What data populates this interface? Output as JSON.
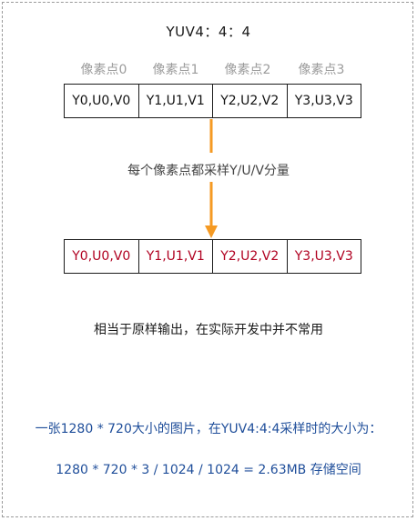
{
  "title": "YUV4：4：4",
  "pixel_labels": [
    "像素点0",
    "像素点1",
    "像素点2",
    "像素点3"
  ],
  "input_row": [
    "Y0,U0,V0",
    "Y1,U1,V1",
    "Y2,U2,V2",
    "Y3,U3,V3"
  ],
  "arrow_caption": "每个像素点都采样Y/U/V分量",
  "output_row": [
    "Y0,U0,V0",
    "Y1,U1,V1",
    "Y2,U2,V2",
    "Y3,U3,V3"
  ],
  "note": "相当于原样输出，在实际开发中并不常用",
  "calc_question": "一张1280 * 720大小的图片，在YUV4:4:4采样时的大小为：",
  "calc_result": "1280 * 720 * 3 / 1024 / 1024 = 2.63MB 存储空间",
  "colors": {
    "arrow": "#f59a23",
    "output_text": "#b00020",
    "calc_text": "#1f4e9a",
    "label_gray": "#9b9b9b"
  }
}
